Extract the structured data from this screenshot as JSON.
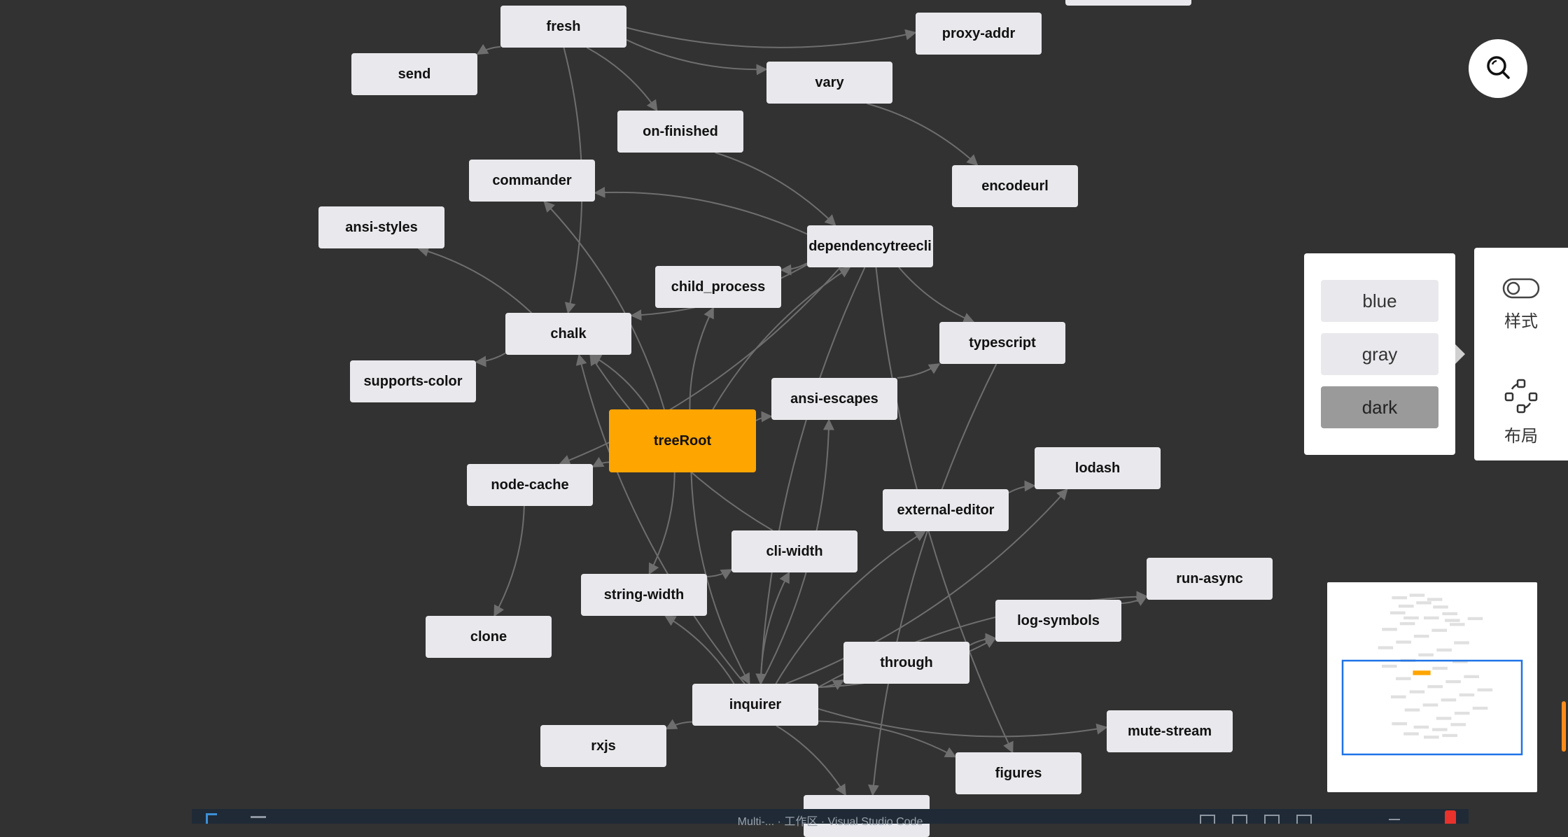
{
  "graph": {
    "root": "treeRoot",
    "nodes": [
      {
        "id": "fresh",
        "label": "fresh"
      },
      {
        "id": "send",
        "label": "send"
      },
      {
        "id": "proxy-addr",
        "label": "proxy-addr"
      },
      {
        "id": "vary",
        "label": "vary"
      },
      {
        "id": "on-finished",
        "label": "on-finished"
      },
      {
        "id": "commander",
        "label": "commander"
      },
      {
        "id": "encodeurl",
        "label": "encodeurl"
      },
      {
        "id": "ansi-styles",
        "label": "ansi-styles"
      },
      {
        "id": "dependencytreecli",
        "label": "dependencytreecli"
      },
      {
        "id": "child_process",
        "label": "child_process"
      },
      {
        "id": "chalk",
        "label": "chalk"
      },
      {
        "id": "typescript",
        "label": "typescript"
      },
      {
        "id": "supports-color",
        "label": "supports-color"
      },
      {
        "id": "ansi-escapes",
        "label": "ansi-escapes"
      },
      {
        "id": "treeRoot",
        "label": "treeRoot"
      },
      {
        "id": "node-cache",
        "label": "node-cache"
      },
      {
        "id": "lodash",
        "label": "lodash"
      },
      {
        "id": "external-editor",
        "label": "external-editor"
      },
      {
        "id": "cli-width",
        "label": "cli-width"
      },
      {
        "id": "string-width",
        "label": "string-width"
      },
      {
        "id": "run-async",
        "label": "run-async"
      },
      {
        "id": "clone",
        "label": "clone"
      },
      {
        "id": "log-symbols",
        "label": "log-symbols"
      },
      {
        "id": "through",
        "label": "through"
      },
      {
        "id": "inquirer",
        "label": "inquirer"
      },
      {
        "id": "rxjs",
        "label": "rxjs"
      },
      {
        "id": "mute-stream",
        "label": "mute-stream"
      },
      {
        "id": "figures",
        "label": "figures"
      },
      {
        "id": "partial-bottom",
        "label": ""
      },
      {
        "id": "partial-top",
        "label": ""
      }
    ],
    "edges": [
      [
        "dependencytreecli",
        "commander"
      ],
      [
        "dependencytreecli",
        "child_process"
      ],
      [
        "dependencytreecli",
        "typescript"
      ],
      [
        "dependencytreecli",
        "chalk"
      ],
      [
        "dependencytreecli",
        "inquirer"
      ],
      [
        "dependencytreecli",
        "node-cache"
      ],
      [
        "dependencytreecli",
        "figures"
      ],
      [
        "on-finished",
        "dependencytreecli"
      ],
      [
        "fresh",
        "send"
      ],
      [
        "fresh",
        "on-finished"
      ],
      [
        "fresh",
        "vary"
      ],
      [
        "fresh",
        "chalk"
      ],
      [
        "fresh",
        "proxy-addr"
      ],
      [
        "vary",
        "encodeurl"
      ],
      [
        "chalk",
        "ansi-styles"
      ],
      [
        "chalk",
        "supports-color"
      ],
      [
        "treeRoot",
        "chalk"
      ],
      [
        "treeRoot",
        "child_process"
      ],
      [
        "treeRoot",
        "commander"
      ],
      [
        "treeRoot",
        "dependencytreecli"
      ],
      [
        "treeRoot",
        "node-cache"
      ],
      [
        "treeRoot",
        "ansi-escapes"
      ],
      [
        "treeRoot",
        "inquirer"
      ],
      [
        "treeRoot",
        "string-width"
      ],
      [
        "ansi-escapes",
        "typescript"
      ],
      [
        "node-cache",
        "clone"
      ],
      [
        "inquirer",
        "rxjs"
      ],
      [
        "inquirer",
        "cli-width"
      ],
      [
        "inquirer",
        "through"
      ],
      [
        "inquirer",
        "external-editor"
      ],
      [
        "inquirer",
        "mute-stream"
      ],
      [
        "inquirer",
        "figures"
      ],
      [
        "inquirer",
        "log-symbols"
      ],
      [
        "inquirer",
        "run-async"
      ],
      [
        "inquirer",
        "string-width"
      ],
      [
        "inquirer",
        "chalk"
      ],
      [
        "inquirer",
        "ansi-escapes"
      ],
      [
        "inquirer",
        "partial-bottom"
      ],
      [
        "inquirer",
        "lodash"
      ],
      [
        "external-editor",
        "lodash"
      ],
      [
        "log-symbols",
        "run-async"
      ],
      [
        "through",
        "log-symbols"
      ],
      [
        "string-width",
        "cli-width"
      ],
      [
        "cli-width",
        "chalk"
      ],
      [
        "typescript",
        "partial-bottom"
      ]
    ]
  },
  "controls": {
    "search_icon": "search-icon",
    "theme_options": [
      {
        "label": "blue",
        "selected": false
      },
      {
        "label": "gray",
        "selected": false
      },
      {
        "label": "dark",
        "selected": true
      }
    ],
    "style_toggle": {
      "label": "样式",
      "icon": "toggle-icon"
    },
    "layout_button": {
      "label": "布局",
      "icon": "refresh-layout-icon"
    }
  },
  "minimap": {
    "label": ""
  },
  "taskbar": {
    "title": "Multi-... · 工作区 · Visual Studio Code"
  },
  "colors": {
    "background": "#323232",
    "node": "#e9e9ed",
    "root_node": "#ffa500",
    "edge": "#6e6e6e",
    "minimap_viewport": "#1e73e8",
    "minimap_node": "#e0e0e0"
  }
}
